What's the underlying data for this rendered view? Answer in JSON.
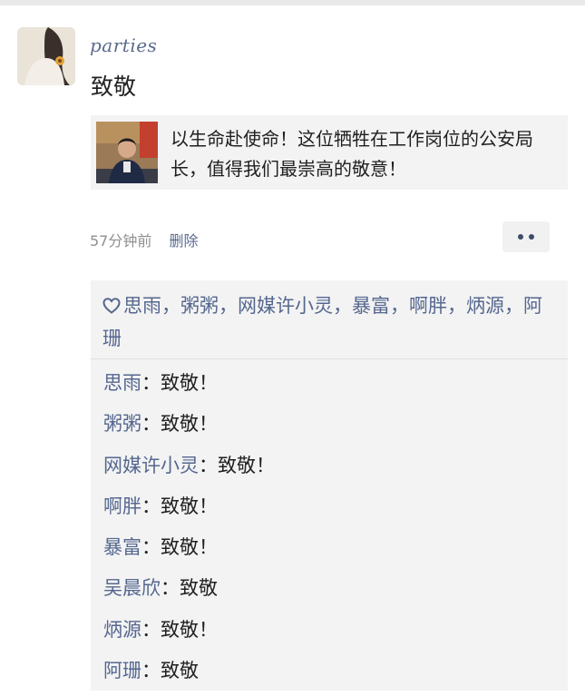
{
  "post": {
    "author": "parties",
    "text": "致敬",
    "share_card": {
      "title": "以生命赴使命！这位牺牲在工作岗位的公安局长，值得我们最崇高的敬意！"
    },
    "time": "57分钟前",
    "delete_label": "删除",
    "likes": {
      "icon": "heart-outline-icon",
      "names": [
        "思雨",
        "粥粥",
        "网媒许小灵",
        "暴富",
        "啊胖",
        "炳源",
        "阿珊"
      ],
      "separator": "，"
    },
    "comments": [
      {
        "name": "思雨",
        "text": "致敬！"
      },
      {
        "name": "粥粥",
        "text": "致敬！"
      },
      {
        "name": "网媒许小灵",
        "text": "致敬！"
      },
      {
        "name": "啊胖",
        "text": "致敬！"
      },
      {
        "name": "暴富",
        "text": "致敬！"
      },
      {
        "name": "吴晨欣",
        "text": "致敬"
      },
      {
        "name": "炳源",
        "text": "致敬！"
      },
      {
        "name": "阿珊",
        "text": "致敬"
      }
    ],
    "comment_sep": "："
  },
  "colors": {
    "name_link": "#55678f",
    "panel_bg": "#f3f3f3",
    "meta_gray": "#8f8f8f"
  }
}
